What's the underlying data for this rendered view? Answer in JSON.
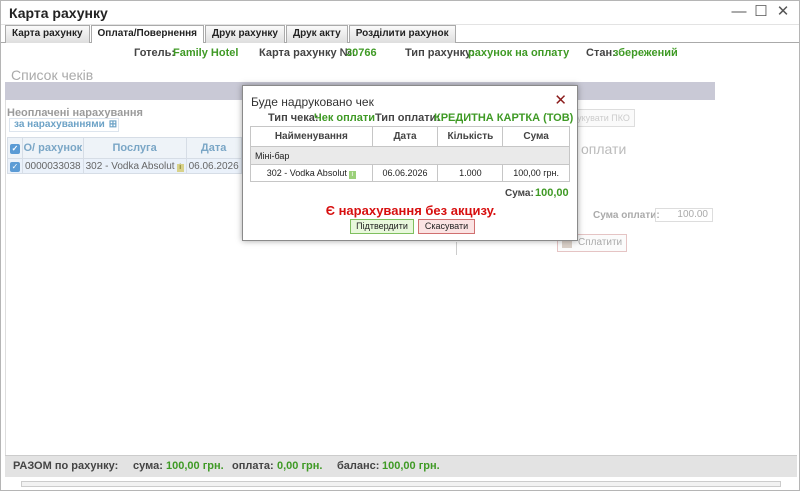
{
  "window": {
    "title": "Карта рахунку",
    "controls": {
      "minimize": "—",
      "maximize": "☐",
      "close": "✕"
    }
  },
  "tabs": [
    {
      "label": "Карта рахунку",
      "active": false
    },
    {
      "label": "Оплата/Повернення",
      "active": true
    },
    {
      "label": "Друк рахунку",
      "active": false
    },
    {
      "label": "Друк акту",
      "active": false
    },
    {
      "label": "Розділити рахунок",
      "active": false
    }
  ],
  "info": {
    "hotel_label": "Готель:",
    "hotel_value": "Family Hotel",
    "card_label": "Карта рахунку №:",
    "card_value": "30766",
    "type_label": "Тип рахунку:",
    "type_value": "рахунок на оплату",
    "state_label": "Стан:",
    "state_value": "збережений"
  },
  "checks_list": {
    "title": "Список чеків"
  },
  "unpaid": {
    "title": "Неоплачені нарахування",
    "filter_label": "за нарахуваннями",
    "filter_icon": "plus-box-icon",
    "columns": [
      "О/ рахунок",
      "Послуга",
      "Дата"
    ],
    "rows": [
      {
        "account": "0000033038",
        "service": "302 - Vodka Absolut",
        "date": "06.06.2026"
      }
    ]
  },
  "background_panel": {
    "pko_button": "Друкувати ПКО",
    "payment_title": "к оплати",
    "sum_label": "Сума оплати:",
    "sum_value": "100.00",
    "pay_button": "Сплатити"
  },
  "footer": {
    "total_label": "РАЗОМ по рахунку:",
    "sum_label": "сума:",
    "sum_value": "100,00 грн.",
    "paid_label": "оплата:",
    "paid_value": "0,00 грн.",
    "balance_label": "баланс:",
    "balance_value": "100,00 грн."
  },
  "dialog": {
    "title": "Буде надруковано чек",
    "close_icon": "✕",
    "check_type_label": "Тип чека:",
    "check_type_value": "Чек оплати",
    "pay_type_label": "Тип оплати:",
    "pay_type_value": "КРЕДИТНА КАРТКА (ТОВ)",
    "columns": [
      "Найменування",
      "Дата",
      "Кількість",
      "Сума"
    ],
    "group": "Міні-бар",
    "items": [
      {
        "name": "302 - Vodka Absolut",
        "date": "06.06.2026",
        "qty": "1.000",
        "sum": "100,00 грн."
      }
    ],
    "sum_label": "Сума:",
    "sum_value": "100,00",
    "warning": "Є нарахування без акцизу.",
    "confirm_label": "Підтвердити",
    "cancel_label": "Скасувати"
  },
  "colors": {
    "accent_green": "#3f9a25",
    "warning_red": "#d70f0f",
    "link_blue": "#6ca2c6"
  }
}
